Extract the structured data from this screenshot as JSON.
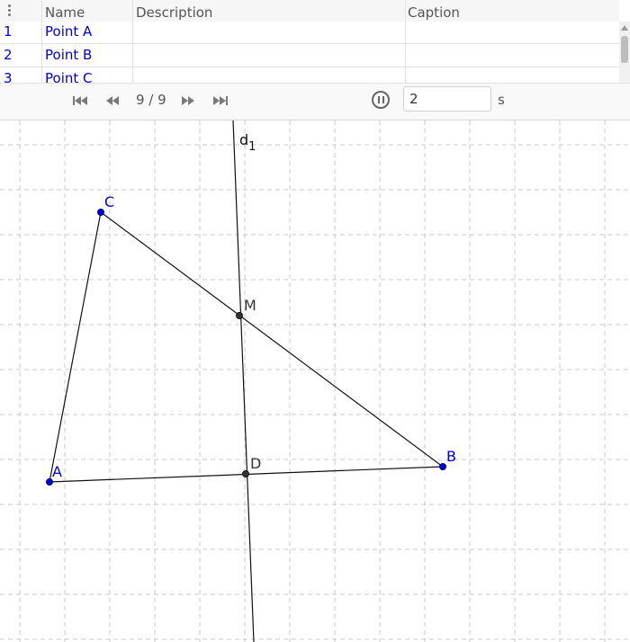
{
  "protocol": {
    "columns": {
      "name": "Name",
      "description": "Description",
      "caption": "Caption"
    },
    "rows": [
      {
        "num": "1",
        "name": "Point A",
        "description": "",
        "caption": ""
      },
      {
        "num": "2",
        "name": "Point B",
        "description": "",
        "caption": ""
      },
      {
        "num": "3",
        "name": "Point C",
        "description": "",
        "caption": ""
      }
    ]
  },
  "navigation": {
    "step_counter": "9 / 9",
    "speed_value": "2",
    "speed_unit": "s"
  },
  "graphics": {
    "labels": {
      "A": "A",
      "B": "B",
      "C": "C",
      "M": "M",
      "D": "D",
      "line": "d",
      "line_subscript": "1"
    },
    "colors": {
      "free_point": "#0000cc",
      "dependent_point": "#333333",
      "grid": "#c8c8c8"
    }
  }
}
